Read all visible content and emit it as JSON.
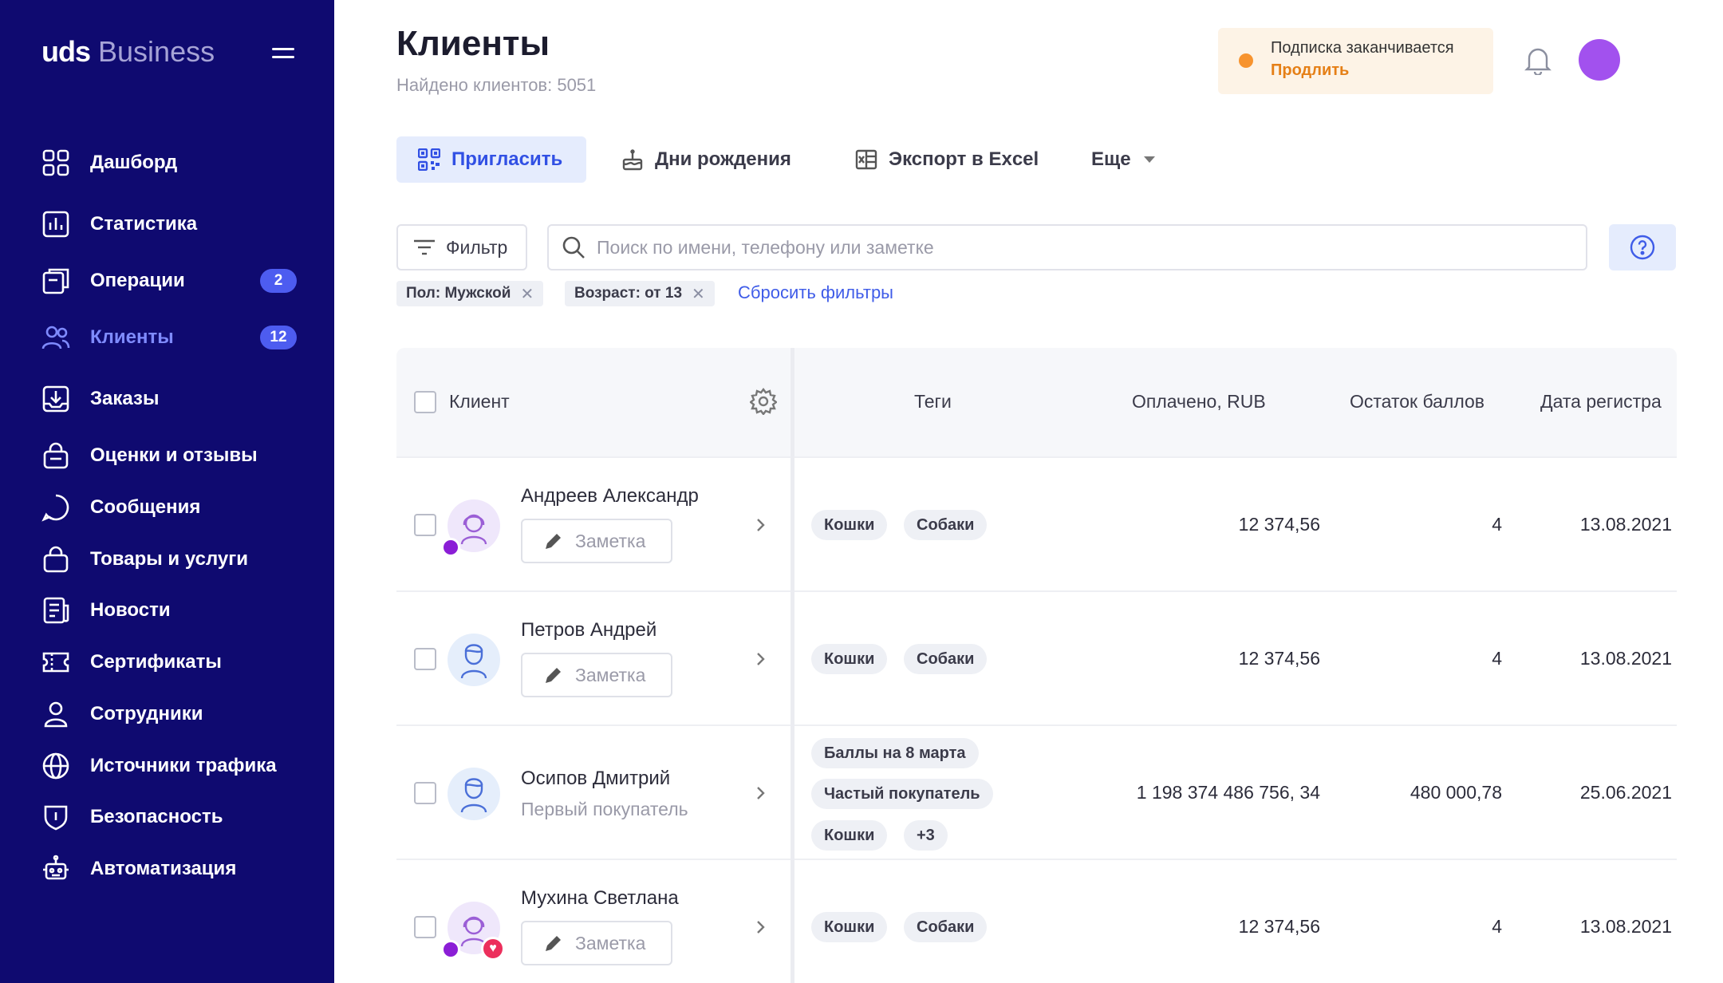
{
  "app": {
    "brand_main": "uds",
    "brand_sub": "Business"
  },
  "sidebar": {
    "items": [
      {
        "label": "Дашборд",
        "icon": "dashboard-icon"
      },
      {
        "label": "Статистика",
        "icon": "chart-icon"
      },
      {
        "label": "Операции",
        "icon": "operations-icon",
        "badge": "2"
      },
      {
        "label": "Клиенты",
        "icon": "clients-icon",
        "badge": "12",
        "active": true
      },
      {
        "label": "Заказы",
        "icon": "orders-icon"
      },
      {
        "label": "Оценки и отзывы",
        "icon": "reviews-icon"
      },
      {
        "label": "Сообщения",
        "icon": "message-icon"
      },
      {
        "label": "Товары и услуги",
        "icon": "bag-icon"
      },
      {
        "label": "Новости",
        "icon": "news-icon"
      },
      {
        "label": "Сертификаты",
        "icon": "certificate-icon"
      },
      {
        "label": "Сотрудники",
        "icon": "employee-icon"
      },
      {
        "label": "Источники трафика",
        "icon": "globe-icon"
      },
      {
        "label": "Безопасность",
        "icon": "shield-icon"
      },
      {
        "label": "Автоматизация",
        "icon": "robot-icon"
      }
    ]
  },
  "header": {
    "title": "Клиенты",
    "found": "Найдено клиентов: 5051",
    "subscription_text": "Подписка заканчивается",
    "subscription_link": "Продлить"
  },
  "actions": {
    "invite": "Пригласить",
    "birthdays": "Дни рождения",
    "export": "Экспорт в Excel",
    "more": "Еще"
  },
  "filters": {
    "button": "Фильтр",
    "search_placeholder": "Поиск по имени, телефону или заметке",
    "chips": [
      "Пол: Мужской",
      "Возраст: от 13"
    ],
    "reset": "Сбросить фильтры"
  },
  "table": {
    "headers": {
      "client": "Клиент",
      "tags": "Теги",
      "paid": "Оплачено, RUB",
      "points": "Остаток баллов",
      "date": "Дата регистра"
    },
    "note_label": "Заметка",
    "rows": [
      {
        "name": "Андреев Александр",
        "tags": [
          "Кошки",
          "Собаки"
        ],
        "paid": "12 374,56",
        "points": "4",
        "date": "13.08.2021"
      },
      {
        "name": "Петров Андрей",
        "tags": [
          "Кошки",
          "Собаки"
        ],
        "paid": "12 374,56",
        "points": "4",
        "date": "13.08.2021"
      },
      {
        "name": "Осипов Дмитрий",
        "subtitle": "Первый покупатель",
        "tags": [
          "Баллы на 8 марта",
          "Частый покупатель",
          "Кошки",
          "+3"
        ],
        "paid": "1 198 374 486 756, 34",
        "points": "480 000,78",
        "date": "25.06.2021"
      },
      {
        "name": "Мухина Светлана",
        "tags": [
          "Кошки",
          "Собаки"
        ],
        "paid": "12 374,56",
        "points": "4",
        "date": "13.08.2021"
      }
    ]
  },
  "colors": {
    "sidebar_bg": "#0f0a70",
    "accent": "#3f5ce8",
    "warning": "#f7932e",
    "avatar": "#a251ee"
  }
}
